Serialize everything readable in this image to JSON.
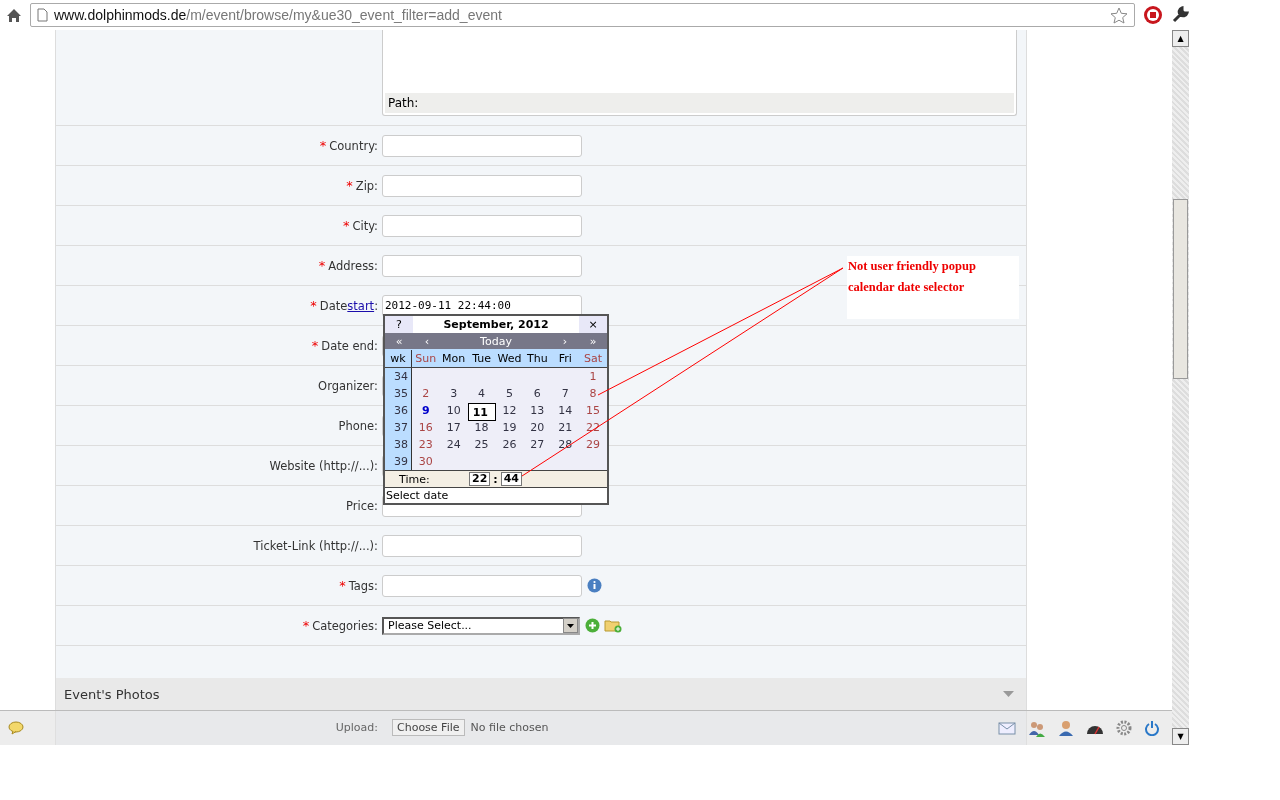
{
  "browser": {
    "url_host": "www.dolphinmods.de",
    "url_path": "/m/event/browse/my&ue30_event_filter=add_event"
  },
  "editor": {
    "path_label": "Path:"
  },
  "fields": [
    {
      "label": "Country:",
      "required_mark": "*",
      "kind": "text"
    },
    {
      "label": "Zip:",
      "required_mark": "*",
      "kind": "text"
    },
    {
      "label": "City:",
      "required_mark": "*",
      "kind": "text"
    },
    {
      "label": "Address:",
      "required_mark": "*",
      "kind": "text"
    },
    {
      "label": "Date",
      "link": "start",
      "suffix": ":",
      "required_mark": "*",
      "kind": "text",
      "value": "2012-09-11 22:44:00"
    },
    {
      "label": "Date end:",
      "required_mark": "*",
      "kind": "text"
    },
    {
      "label": "Organizer:",
      "kind": "text"
    },
    {
      "label": "Phone:",
      "kind": "text"
    },
    {
      "label": "Website (http://...):",
      "kind": "text"
    },
    {
      "label": "Price:",
      "kind": "text"
    },
    {
      "label": "Ticket-Link (http://...):",
      "kind": "text"
    },
    {
      "label": "Tags:",
      "required_mark": "*",
      "kind": "tags"
    },
    {
      "label": "Categories:",
      "required_mark": "*",
      "kind": "select",
      "value": "Please Select..."
    }
  ],
  "scroll_arrows": [
    "▲",
    "▼"
  ],
  "section": {
    "title": "Event's Photos",
    "upload_label": "Upload:",
    "choose_button": "Choose File",
    "file_status": "No file chosen"
  },
  "calendar": {
    "help": "?",
    "title": "September, 2012",
    "close": "×",
    "nav": [
      "«",
      "‹",
      "Today",
      "›",
      "»"
    ],
    "week_header": "wk",
    "weekdays": [
      "Sun",
      "Mon",
      "Tue",
      "Wed",
      "Thu",
      "Fri",
      "Sat"
    ],
    "weeks": [
      {
        "wk": "34",
        "days": [
          {
            "day": "1",
            "today": false,
            "selected": false
          }
        ]
      },
      {
        "wk": "35",
        "days": [
          {
            "day": "2",
            "today": false,
            "selected": false
          },
          {
            "day": "3",
            "today": false,
            "selected": false
          },
          {
            "day": "4",
            "today": false,
            "selected": false
          },
          {
            "day": "5",
            "today": false,
            "selected": false
          },
          {
            "day": "6",
            "today": false,
            "selected": false
          },
          {
            "day": "7",
            "today": false,
            "selected": false
          },
          {
            "day": "8",
            "today": false,
            "selected": false
          }
        ]
      },
      {
        "wk": "36",
        "days": [
          {
            "day": "9",
            "today": true,
            "selected": false
          },
          {
            "day": "10",
            "today": false,
            "selected": false
          },
          {
            "day": "11",
            "today": false,
            "selected": true
          },
          {
            "day": "12",
            "today": false,
            "selected": false
          },
          {
            "day": "13",
            "today": false,
            "selected": false
          },
          {
            "day": "14",
            "today": false,
            "selected": false
          },
          {
            "day": "15",
            "today": false,
            "selected": false
          }
        ]
      },
      {
        "wk": "37",
        "days": [
          {
            "day": "16",
            "today": false,
            "selected": false
          },
          {
            "day": "17",
            "today": false,
            "selected": false
          },
          {
            "day": "18",
            "today": false,
            "selected": false
          },
          {
            "day": "19",
            "today": false,
            "selected": false
          },
          {
            "day": "20",
            "today": false,
            "selected": false
          },
          {
            "day": "21",
            "today": false,
            "selected": false
          },
          {
            "day": "22",
            "today": false,
            "selected": false
          }
        ]
      },
      {
        "wk": "38",
        "days": [
          {
            "day": "23",
            "today": false,
            "selected": false
          },
          {
            "day": "24",
            "today": false,
            "selected": false
          },
          {
            "day": "25",
            "today": false,
            "selected": false
          },
          {
            "day": "26",
            "today": false,
            "selected": false
          },
          {
            "day": "27",
            "today": false,
            "selected": false
          },
          {
            "day": "28",
            "today": false,
            "selected": false
          },
          {
            "day": "29",
            "today": false,
            "selected": false
          }
        ]
      },
      {
        "wk": "39",
        "days": [
          {
            "day": "30",
            "today": false,
            "selected": false
          }
        ]
      }
    ],
    "time_label": "Time:",
    "hour": "22",
    "sep": ":",
    "minute": "44",
    "status": "Select date"
  },
  "annotation": {
    "text": "Not user friendly popup calendar date selector"
  }
}
